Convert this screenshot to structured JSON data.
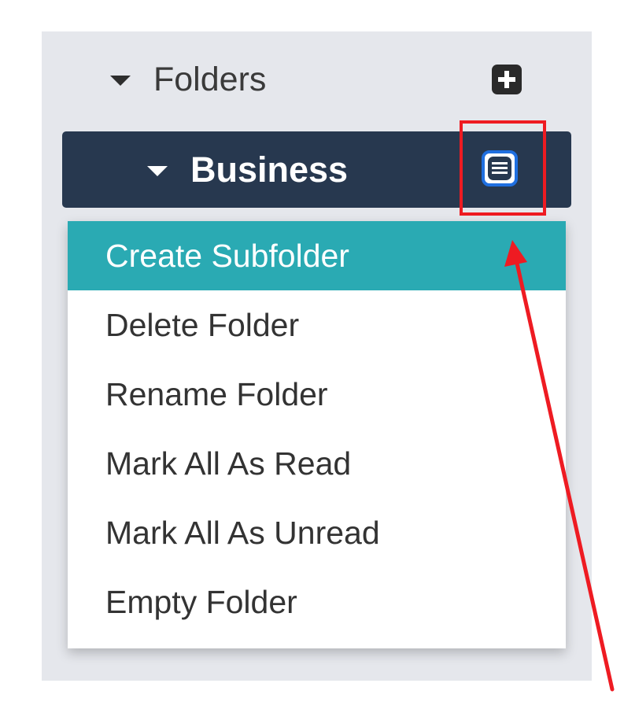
{
  "sidebar": {
    "folders_title": "Folders",
    "business_label": "Business",
    "menu_items": [
      "Create Subfolder",
      "Delete Folder",
      "Rename Folder",
      "Mark All As Read",
      "Mark All As Unread",
      "Empty Folder"
    ]
  },
  "icons": {
    "folders_toggle": "caret-down-icon",
    "add_folder": "plus-square-icon",
    "business_toggle": "caret-down-icon",
    "folder_menu": "hamburger-menu-icon",
    "annotation": "red-arrow-icon"
  },
  "colors": {
    "panel_bg": "#e5e7ec",
    "folder_row_bg": "#27384f",
    "active_menu_bg": "#2aaab3",
    "menu_button_border": "#1f6fe0",
    "annotation": "#ee1b22"
  }
}
